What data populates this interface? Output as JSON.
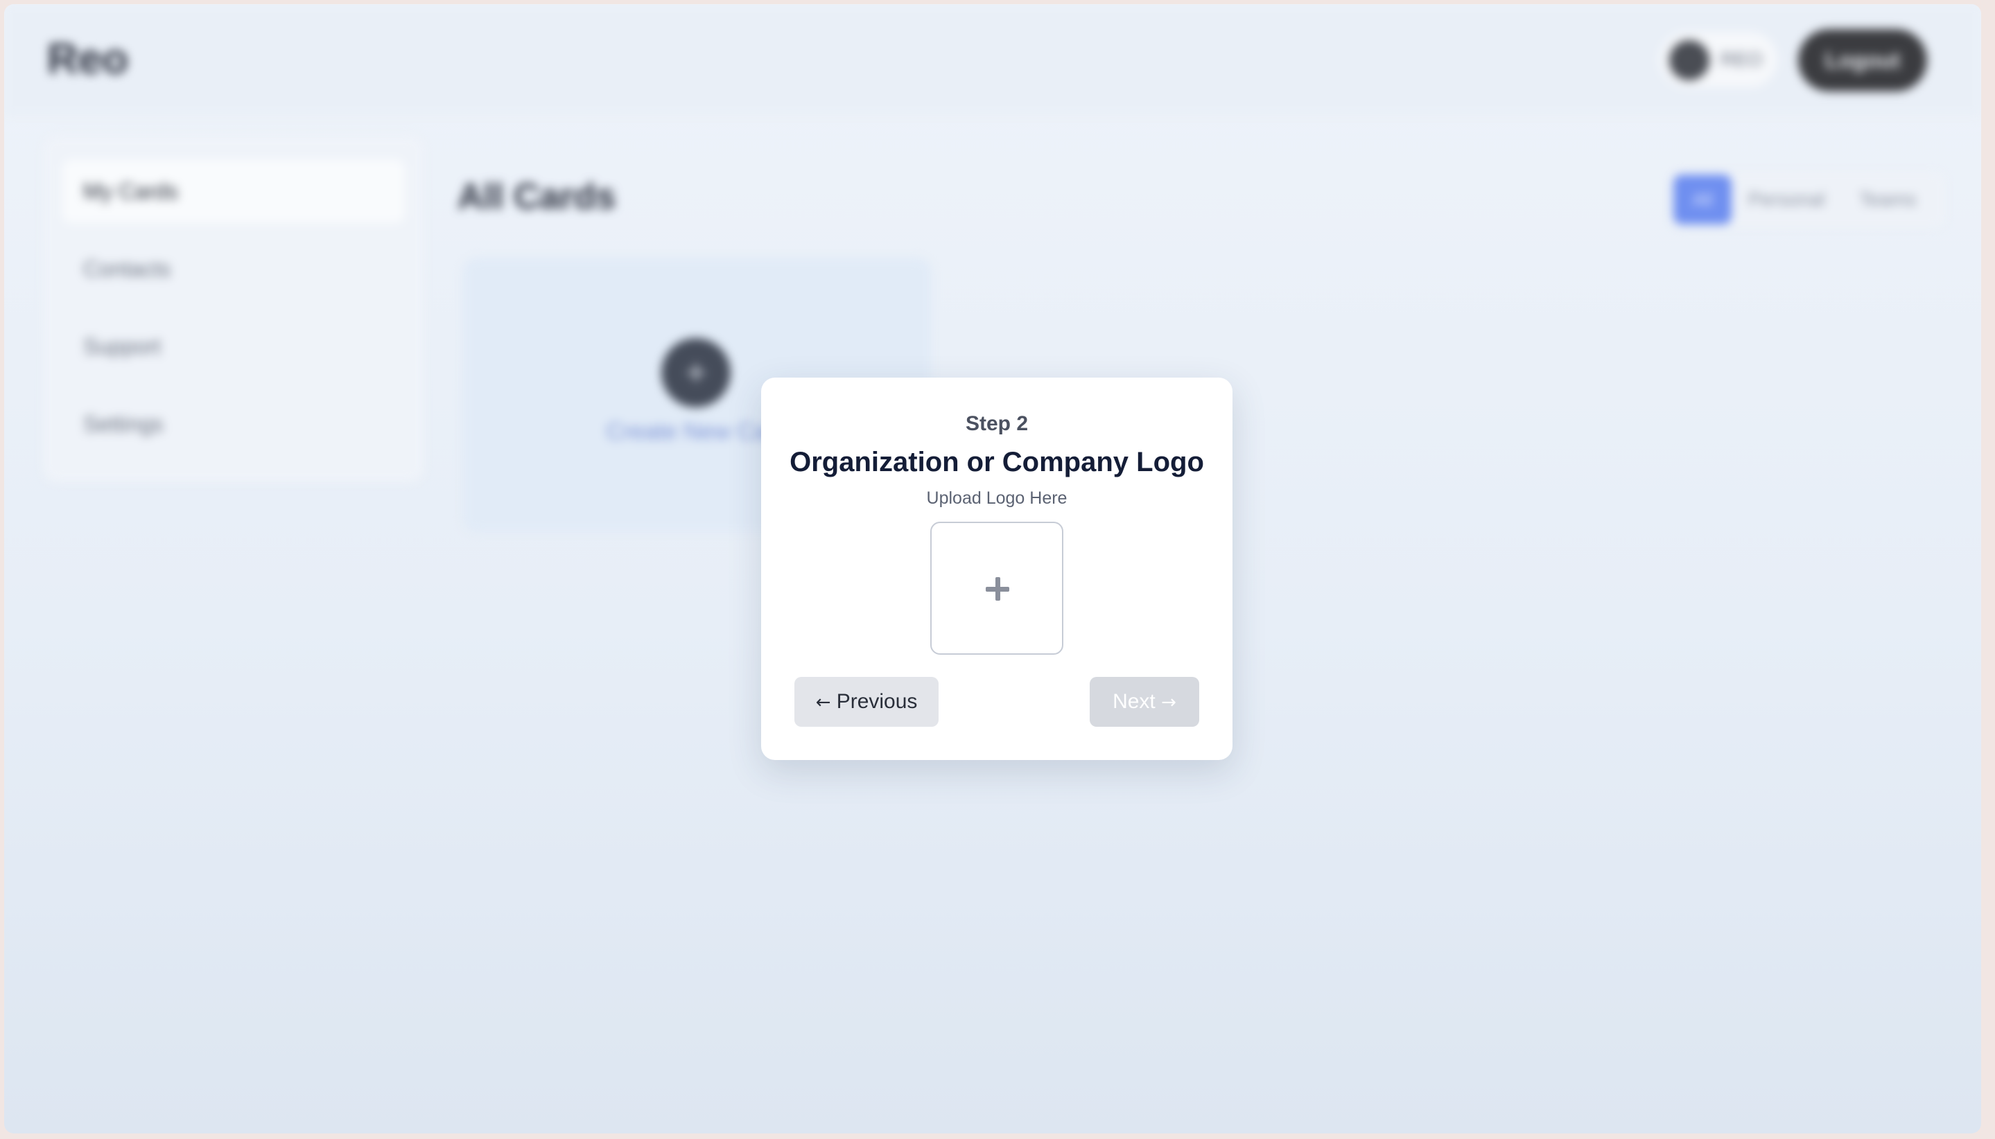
{
  "app": {
    "logo": "Reo",
    "user_name": "REO",
    "logout_label": "Logout"
  },
  "sidebar": {
    "items": [
      {
        "label": "My Cards",
        "active": true
      },
      {
        "label": "Contacts",
        "active": false
      },
      {
        "label": "Support",
        "active": false
      },
      {
        "label": "Settings",
        "active": false
      }
    ]
  },
  "main": {
    "title": "All Cards",
    "filters": [
      "All",
      "Personal",
      "Teams"
    ],
    "create_card_icon": "plus-icon",
    "create_card_label": "Create New Card"
  },
  "modal": {
    "step": "Step 2",
    "title": "Organization or Company Logo",
    "hint": "Upload Logo Here",
    "upload_icon": "plus-icon",
    "prev_arrow": "←",
    "prev_label": "Previous",
    "next_label": "Next",
    "next_arrow": "→"
  },
  "colors": {
    "accent": "#6f8ff0",
    "modal_title": "#141d37",
    "button_disabled": "#d6d9df",
    "button_secondary": "#e3e5ea"
  }
}
